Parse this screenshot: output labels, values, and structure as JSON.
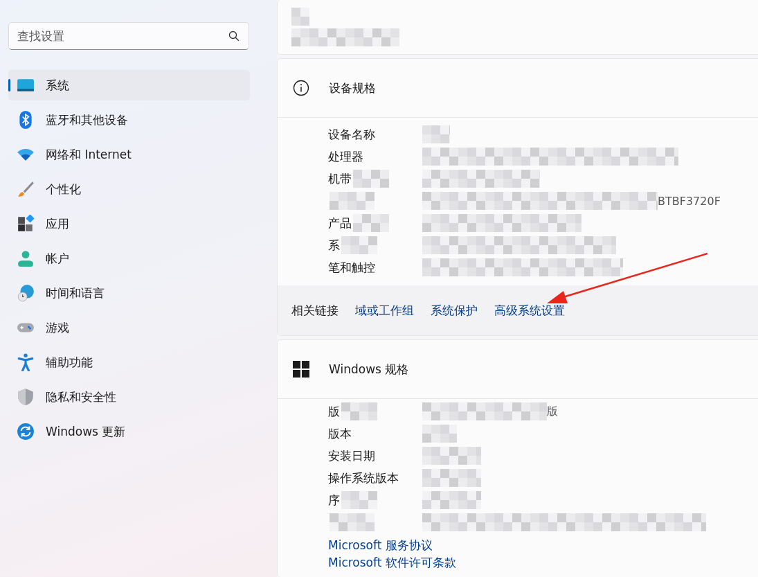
{
  "search": {
    "placeholder": "查找设置"
  },
  "sidebar": {
    "items": [
      {
        "label": "系统",
        "selected": true
      },
      {
        "label": "蓝牙和其他设备",
        "selected": false
      },
      {
        "label": "网络和 Internet",
        "selected": false
      },
      {
        "label": "个性化",
        "selected": false
      },
      {
        "label": "应用",
        "selected": false
      },
      {
        "label": "帐户",
        "selected": false
      },
      {
        "label": "时间和语言",
        "selected": false
      },
      {
        "label": "游戏",
        "selected": false
      },
      {
        "label": "辅助功能",
        "selected": false
      },
      {
        "label": "隐私和安全性",
        "selected": false
      },
      {
        "label": "Windows 更新",
        "selected": false
      }
    ]
  },
  "device_card": {
    "blurred": true
  },
  "device_spec": {
    "title": "设备规格",
    "rows": [
      {
        "label": "设备名称",
        "label_blurred": false
      },
      {
        "label": "处理器",
        "label_blurred": false
      },
      {
        "label": "机带",
        "label_blurred": true
      },
      {
        "label_blurred": true,
        "value": "BTBF3720F"
      },
      {
        "label": "产品",
        "label_blurred": true
      },
      {
        "label": "系",
        "label_blurred": true
      },
      {
        "label": "笔和触控",
        "label_blurred": false
      }
    ]
  },
  "related_links": {
    "label": "相关链接",
    "links": [
      "域或工作组",
      "系统保护",
      "高级系统设置"
    ]
  },
  "windows_spec": {
    "title": "Windows 规格",
    "rows": [
      {
        "label": "版",
        "label_blurred": true,
        "value": "版"
      },
      {
        "label": "版本",
        "label_blurred": false
      },
      {
        "label": "安装日期",
        "label_blurred": false
      },
      {
        "label": "操作系统版本",
        "label_blurred": false
      },
      {
        "label": "序",
        "label_blurred": true
      },
      {
        "label_blurred": true
      }
    ],
    "links": [
      "Microsoft 服务协议",
      "Microsoft 软件许可条款"
    ]
  },
  "annotation": {
    "kind": "arrow"
  }
}
